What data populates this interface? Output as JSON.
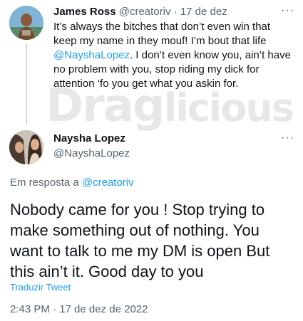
{
  "reply_tweet": {
    "author_name": "James Ross",
    "author_handle": "@creatoriv",
    "date": "17 de dez",
    "more_label": "···",
    "text_before_mention": "It’s always the bitches that don’t even win that keep my name in they mouf! I’m bout that life ",
    "mention": "@NayshaLopez",
    "text_after_mention": ". I don’t even know you, ain’t have no problem with you, stop riding my dick for attention ‘fo you get what you askin for."
  },
  "watermark": {
    "part1": "Drag",
    "part2": "licious"
  },
  "main_tweet": {
    "author_name": "Naysha Lopez",
    "author_handle": "@NayshaLopez",
    "more_label": "···",
    "reply_prefix": "Em resposta a ",
    "reply_mention": "@creatoriv",
    "text": "Nobody came for you !  Stop trying to make something out of nothing.  You want to talk to me my DM is open But this ain’t it. Good day to you",
    "translate_label": "Traduzir Tweet",
    "timestamp": "2:43 PM · 17 de dez de 2022"
  },
  "colors": {
    "text": "#0f1419",
    "secondary": "#536471",
    "link": "#1d9bf0",
    "thread_line": "#cfd9de"
  }
}
